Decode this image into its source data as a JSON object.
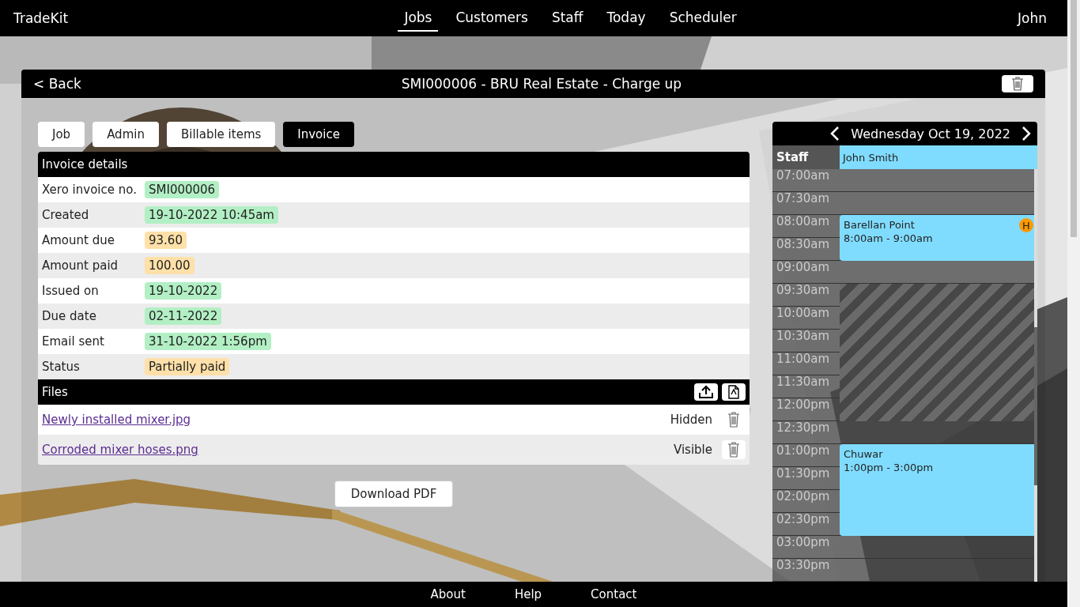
{
  "nav": {
    "brand": "TradeKit",
    "items": [
      {
        "label": "Jobs",
        "selected": true
      },
      {
        "label": "Customers",
        "selected": false
      },
      {
        "label": "Staff",
        "selected": false
      },
      {
        "label": "Today",
        "selected": false
      },
      {
        "label": "Scheduler",
        "selected": false
      }
    ],
    "user": "John"
  },
  "job": {
    "back": "< Back",
    "title": "SMI000006 - BRU Real Estate - Charge up"
  },
  "tabs": [
    {
      "label": "Job",
      "selected": false
    },
    {
      "label": "Admin",
      "selected": false
    },
    {
      "label": "Billable items",
      "selected": false
    },
    {
      "label": "Invoice",
      "selected": true
    }
  ],
  "invoice": {
    "title": "Invoice details",
    "rows": [
      {
        "label": "Xero invoice no.",
        "value": "SMI000006",
        "color": "#b2efc4"
      },
      {
        "label": "Created",
        "value": "19-10-2022 10:45am",
        "color": "#b2efc4"
      },
      {
        "label": "Amount due",
        "value": "93.60",
        "color": "#ffe0a8"
      },
      {
        "label": "Amount paid",
        "value": "100.00",
        "color": "#ffe0a8"
      },
      {
        "label": "Issued on",
        "value": "19-10-2022",
        "color": "#b2efc4"
      },
      {
        "label": "Due date",
        "value": "02-11-2022",
        "color": "#b2efc4"
      },
      {
        "label": "Email sent",
        "value": "31-10-2022 1:56pm",
        "color": "#b2efc4"
      },
      {
        "label": "Status",
        "value": "Partially paid",
        "color": "#ffe0a8"
      }
    ]
  },
  "files": {
    "title": "Files",
    "items": [
      {
        "name": "Newly installed mixer.jpg",
        "visibility": "Hidden"
      },
      {
        "name": "Corroded mixer hoses.png",
        "visibility": "Visible"
      }
    ]
  },
  "download": "Download PDF",
  "calendar": {
    "date": "Wednesday Oct 19, 2022",
    "staff_label": "Staff",
    "staff": "John Smith",
    "slots": [
      {
        "time": "07:00am",
        "kind": "free"
      },
      {
        "time": "07:30am",
        "kind": "free"
      },
      {
        "time": "08:00am",
        "kind": "event-start",
        "event": {
          "title": "Barellan Point",
          "time": "8:00am - 9:00am",
          "badge": "H"
        }
      },
      {
        "time": "08:30am",
        "kind": "event"
      },
      {
        "time": "09:00am",
        "kind": "free"
      },
      {
        "time": "09:30am",
        "kind": "blocked"
      },
      {
        "time": "10:00am",
        "kind": "blocked"
      },
      {
        "time": "10:30am",
        "kind": "blocked"
      },
      {
        "time": "11:00am",
        "kind": "blocked"
      },
      {
        "time": "11:30am",
        "kind": "blocked"
      },
      {
        "time": "12:00pm",
        "kind": "blocked"
      },
      {
        "time": "12:30pm",
        "kind": "free"
      },
      {
        "time": "01:00pm",
        "kind": "event-start",
        "event": {
          "title": "Chuwar",
          "time": "1:00pm - 3:00pm"
        }
      },
      {
        "time": "01:30pm",
        "kind": "event"
      },
      {
        "time": "02:00pm",
        "kind": "event"
      },
      {
        "time": "02:30pm",
        "kind": "event"
      },
      {
        "time": "03:00pm",
        "kind": "free"
      },
      {
        "time": "03:30pm",
        "kind": "free"
      }
    ]
  },
  "footer": [
    "About",
    "Help",
    "Contact"
  ]
}
